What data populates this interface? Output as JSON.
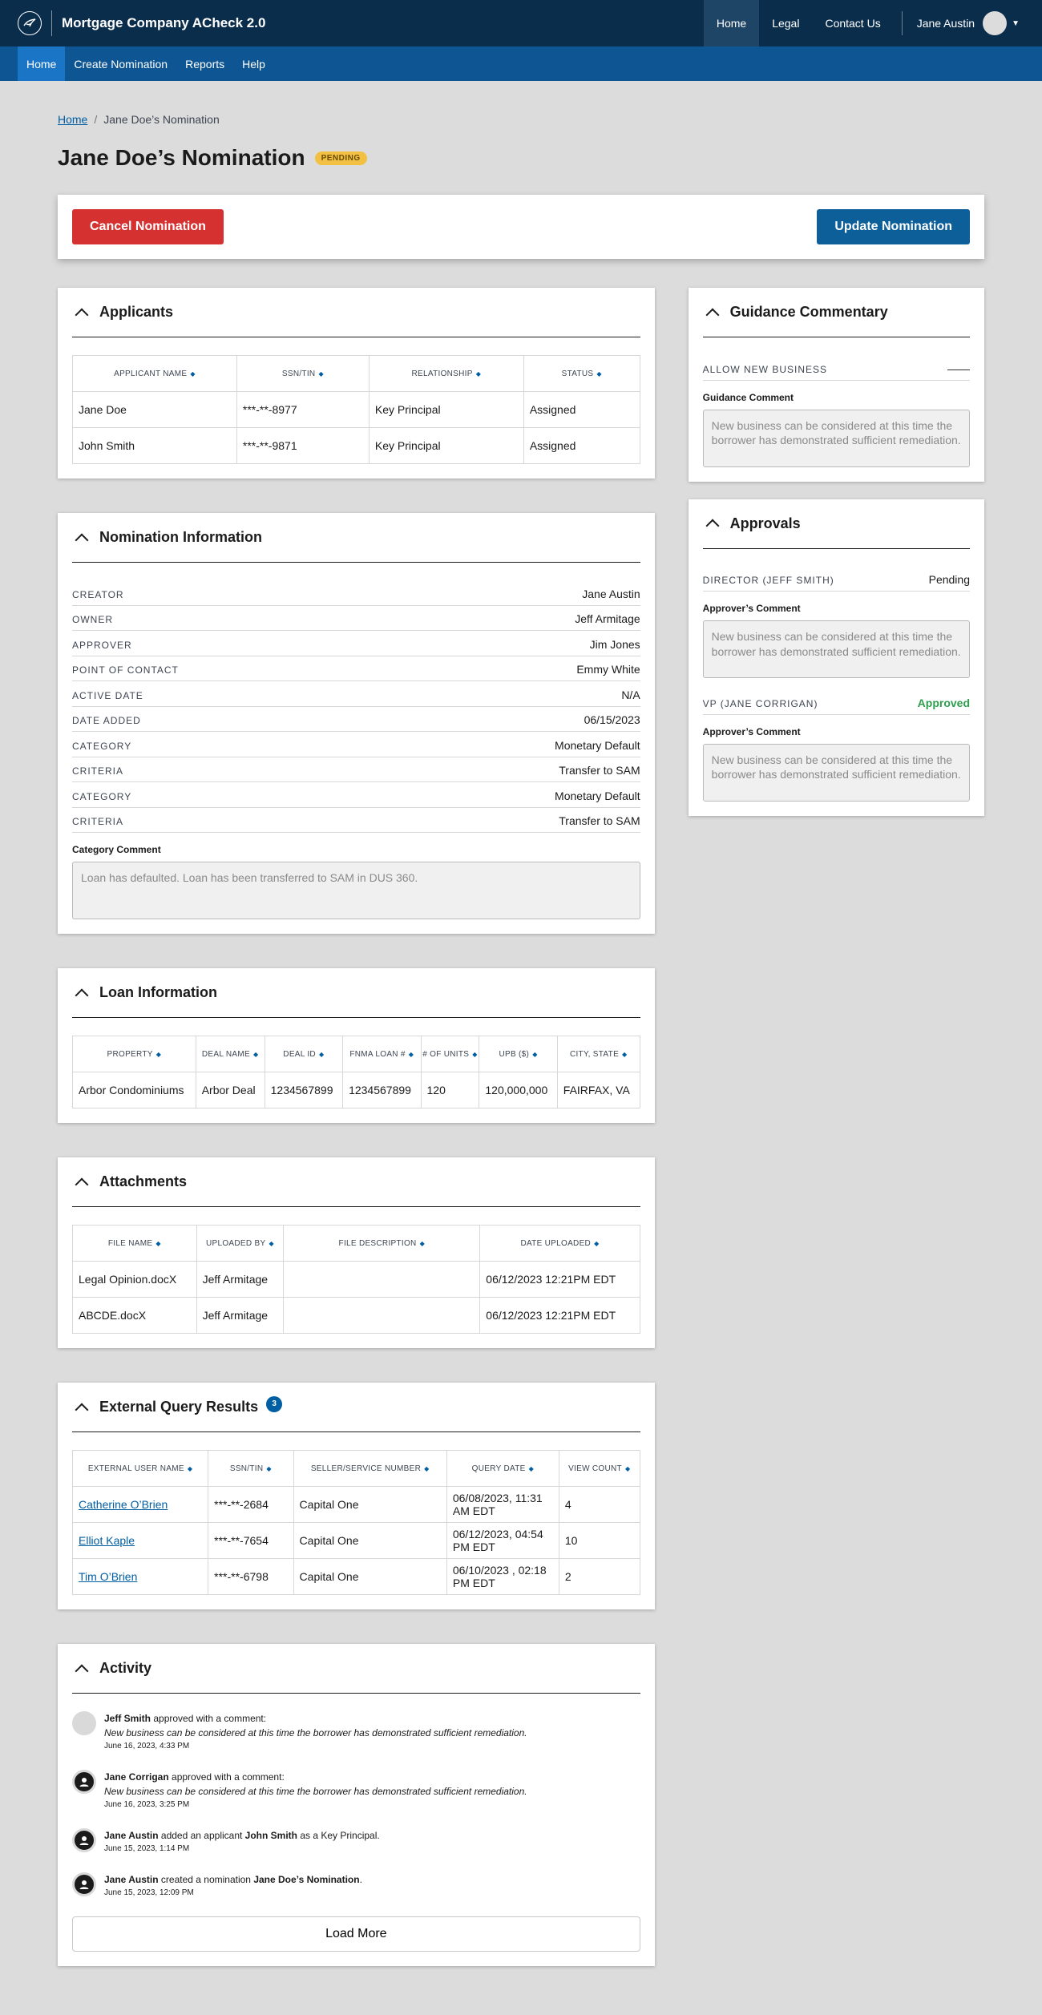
{
  "header": {
    "brand": "Mortgage Company ACheck 2.0",
    "nav": [
      "Home",
      "Legal",
      "Contact Us"
    ],
    "user": "Jane Austin"
  },
  "subnav": [
    "Home",
    "Create Nomination",
    "Reports",
    "Help"
  ],
  "breadcrumb": {
    "home": "Home",
    "current": "Jane Doe’s Nomination"
  },
  "title": "Jane Doe’s Nomination",
  "status": "PENDING",
  "actions": {
    "cancel": "Cancel Nomination",
    "update": "Update Nomination"
  },
  "applicants": {
    "title": "Applicants",
    "columns": [
      "APPLICANT NAME",
      "SSN/TIN",
      "RELATIONSHIP",
      "STATUS"
    ],
    "rows": [
      [
        "Jane Doe",
        "***-**-8977",
        "Key Principal",
        "Assigned"
      ],
      [
        "John Smith",
        "***-**-9871",
        "Key Principal",
        "Assigned"
      ]
    ]
  },
  "nomination": {
    "title": "Nomination Information",
    "fields": [
      {
        "k": "CREATOR",
        "v": "Jane Austin"
      },
      {
        "k": "OWNER",
        "v": "Jeff Armitage"
      },
      {
        "k": "APPROVER",
        "v": "Jim Jones"
      },
      {
        "k": "POINT OF CONTACT",
        "v": "Emmy White"
      },
      {
        "k": "ACTIVE DATE",
        "v": "N/A"
      },
      {
        "k": "DATE ADDED",
        "v": "06/15/2023"
      },
      {
        "k": "CATEGORY",
        "v": "Monetary Default"
      },
      {
        "k": "CRITERIA",
        "v": "Transfer to SAM"
      },
      {
        "k": "CATEGORY",
        "v": "Monetary Default"
      },
      {
        "k": "CRITERIA",
        "v": "Transfer to SAM"
      }
    ],
    "comment_label": "Category Comment",
    "comment": "Loan has defaulted. Loan has been transferred to SAM in DUS 360."
  },
  "loan": {
    "title": "Loan Information",
    "columns": [
      "PROPERTY",
      "DEAL NAME",
      "DEAL ID",
      "FNMA LOAN #",
      "# OF UNITS",
      "UPB ($)",
      "CITY, STATE"
    ],
    "rows": [
      [
        "Arbor Condominiums",
        "Arbor Deal",
        "1234567899",
        "1234567899",
        "120",
        "120,000,000",
        "FAIRFAX, VA"
      ]
    ]
  },
  "attachments": {
    "title": "Attachments",
    "columns": [
      "FILE NAME",
      "UPLOADED BY",
      "FILE DESCRIPTION",
      "DATE UPLOADED"
    ],
    "rows": [
      [
        "Legal Opinion.docX",
        "Jeff Armitage",
        "",
        "06/12/2023 12:21PM EDT"
      ],
      [
        "ABCDE.docX",
        "Jeff Armitage",
        "",
        "06/12/2023 12:21PM EDT"
      ]
    ]
  },
  "external": {
    "title": "External Query Results",
    "count": "3",
    "columns": [
      "EXTERNAL USER NAME",
      "SSN/TIN",
      "SELLER/SERVICE NUMBER",
      "QUERY DATE",
      "VIEW COUNT"
    ],
    "rows": [
      [
        "Catherine O’Brien",
        "***-**-2684",
        "Capital One",
        "06/08/2023, 11:31 AM EDT",
        "4"
      ],
      [
        "Elliot Kaple",
        "***-**-7654",
        "Capital One",
        "06/12/2023, 04:54 PM EDT",
        "10"
      ],
      [
        "Tim O’Brien",
        "***-**-6798",
        "Capital One",
        "06/10/2023 , 02:18 PM EDT",
        "2"
      ]
    ]
  },
  "activity": {
    "title": "Activity",
    "items": [
      {
        "name": "Jeff Smith",
        "text": " approved with a comment:",
        "comment": "New business  can be considered at this time the borrower has demonstrated sufficient remediation.",
        "time": "June 16, 2023, 4:33 PM"
      },
      {
        "name": "Jane Corrigan",
        "text": " approved with a comment:",
        "comment": "New business  can be considered at this time the borrower has demonstrated sufficient remediation.",
        "time": "June 16, 2023, 3:25 PM"
      },
      {
        "name": "Jane Austin",
        "text": " added an applicant ",
        "bold2": "John Smith",
        "text2": " as a Key Principal.",
        "time": "June 15, 2023, 1:14 PM"
      },
      {
        "name": "Jane Austin",
        "text": " created a nomination ",
        "bold2": "Jane Doe’s Nomination",
        "text2": ".",
        "time": "June 15, 2023, 12:09 PM"
      }
    ],
    "load_more": "Load More"
  },
  "guidance": {
    "title": "Guidance Commentary",
    "key": "ALLOW NEW BUSINESS",
    "value": "——",
    "comment_label": "Guidance Comment",
    "comment": "New business  can be considered at this time the borrower has demonstrated sufficient remediation."
  },
  "approvals": {
    "title": "Approvals",
    "items": [
      {
        "key": "DIRECTOR (JEFF SMITH)",
        "value": "Pending",
        "comment_label": "Approver’s Comment",
        "comment": "New business  can be considered at this time the borrower has demonstrated sufficient remediation."
      },
      {
        "key": "VP (JANE CORRIGAN)",
        "value": "Approved",
        "comment_label": "Approver’s Comment",
        "comment": "New business  can be considered at this time the borrower has demonstrated sufficient remediation."
      }
    ]
  },
  "colors": {
    "header": "#0b2d4c",
    "subnav": "#0e5693",
    "primary": "#0d5f9a",
    "danger": "#d63131",
    "pending": "#f2c144",
    "approved": "#2e9e4e"
  }
}
